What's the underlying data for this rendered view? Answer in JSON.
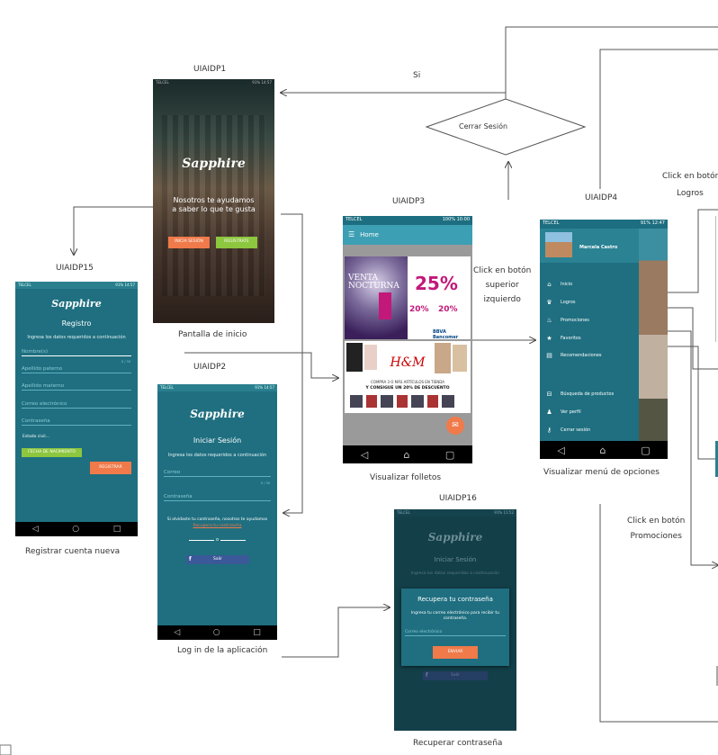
{
  "screens": {
    "p1": {
      "id": "UIAIDP1",
      "caption": "Pantalla de inicio",
      "logo": "Sapphire",
      "tagline": "Nosotros te ayudamos a saber lo que te gusta",
      "btn_login": "INICIA SESIÓN",
      "btn_register": "REGÍSTRATE"
    },
    "p2": {
      "id": "UIAIDP2",
      "caption": "Log in de la aplicación",
      "logo": "Sapphire",
      "title": "Iniciar Sesión",
      "subtitle": "Ingresa los datos requeridos a continuación",
      "field_email": "Correo",
      "field_password": "Contraseña",
      "counter": "0 / 30",
      "forgot_text": "Si olvidaste tu contraseña, nosotros te ayudamos",
      "forgot_link": "Recupera tu contraseña",
      "or": "o",
      "facebook": "Salir"
    },
    "p3": {
      "id": "UIAIDP3",
      "caption": "Visualizar folletos",
      "statusbar_left": "TELCEL",
      "statusbar_right": "100% 10:00",
      "title": "Home",
      "flyer1_title": "VENTA NOCTURNA",
      "flyer1_big": "25%",
      "flyer1_pct2": "20%",
      "flyer1_pct3": "20%",
      "flyer1_bank": "BBVA Bancomer",
      "flyer2_brand": "H&M",
      "flyer2_line1": "COMPRA 3 O MÁS ARTÍCULOS EN TIENDA",
      "flyer2_line2": "Y CONSIGUE UN 20% DE DESCUENTO"
    },
    "p4": {
      "id": "UIAIDP4",
      "caption": "Visualizar menú de opciones",
      "statusbar_left": "TELCEL",
      "statusbar_right": "91% 12:47",
      "user": "Marcela Castro",
      "menu": [
        "Inicio",
        "Logros",
        "Promociones",
        "Favoritos",
        "Recomendaciones",
        "Búsqueda de productos",
        "Ver perfil",
        "Cerrar sesión"
      ]
    },
    "p15": {
      "id": "UIAIDP15",
      "caption": "Registrar cuenta nueva",
      "logo": "Sapphire",
      "title": "Registro",
      "subtitle": "Ingresa los datos requeridos a continuación",
      "fields": [
        "Nombre(s)",
        "Apellido paterno",
        "Apellido materno",
        "Correo electrónico",
        "Contraseña"
      ],
      "counter": "0 / 30",
      "civil": "Estado civil...",
      "btn_birth": "FECHA DE NACIMIENTO",
      "btn_register": "REGISTRAR"
    },
    "p16": {
      "id": "UIAIDP16",
      "caption": "Recuperar contraseña",
      "logo": "Sapphire",
      "bg_title": "Iniciar Sesión",
      "bg_subtitle": "Ingresa los datos requeridos a continuación",
      "dialog_title": "Recupera tu contraseña",
      "dialog_text": "Ingresa tu correo electrónico para recibir tu contraseña.",
      "dialog_field": "Correo electrónico",
      "dialog_btn": "ENVIAR",
      "facebook": "Salir"
    }
  },
  "flow": {
    "decision": "Cerrar Sesión",
    "yes": "Si",
    "click_menu": [
      "Click en botón",
      "superior",
      "izquierdo"
    ],
    "click_logros": [
      "Click en botón",
      "Logros"
    ],
    "click_promos": [
      "Click en botón",
      "Promociones"
    ]
  },
  "colors": {
    "teal": "#1f6f80",
    "teal_dark": "#133f49",
    "orange": "#f07a4a",
    "green": "#8dc63f",
    "statusbar": "#2a7f8f"
  }
}
